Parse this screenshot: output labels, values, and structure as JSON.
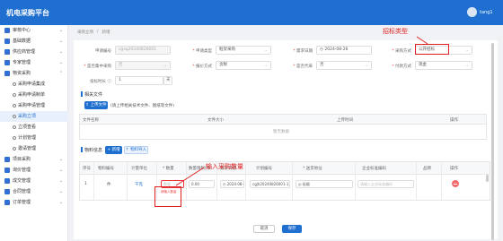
{
  "header": {
    "app_title": "机电采购平台",
    "user_name": "tang1"
  },
  "sidebar": {
    "items": [
      {
        "label": "审核中心",
        "type": "group"
      },
      {
        "label": "基础数据",
        "type": "group"
      },
      {
        "label": "供应商管理",
        "type": "group"
      },
      {
        "label": "专家管理",
        "type": "group"
      },
      {
        "label": "物资采购",
        "type": "group"
      },
      {
        "label": "采购申请集成",
        "type": "sub"
      },
      {
        "label": "采购申请制单",
        "type": "sub"
      },
      {
        "label": "采购申请管理",
        "type": "sub"
      },
      {
        "label": "采购立项",
        "type": "sub"
      },
      {
        "label": "立项查看",
        "type": "sub"
      },
      {
        "label": "计划管理",
        "type": "sub"
      },
      {
        "label": "邀请管理",
        "type": "sub"
      },
      {
        "label": "项目采购",
        "type": "group"
      },
      {
        "label": "询价管理",
        "type": "group"
      },
      {
        "label": "成交管理",
        "type": "group"
      },
      {
        "label": "合同管理",
        "type": "group"
      },
      {
        "label": "订单管理",
        "type": "group"
      }
    ]
  },
  "breadcrumb": [
    "采购立项",
    "新增"
  ],
  "form": {
    "fields": [
      {
        "label": "申请编号",
        "value": "cgsq20240826001",
        "disabled": true,
        "required": false
      },
      {
        "label": "申请类型",
        "value": "框架采购",
        "required": true,
        "select": true
      },
      {
        "label": "需求日期",
        "value": "2024-08-26",
        "required": true,
        "date": true
      },
      {
        "label": "采购方式",
        "value": "公开招标",
        "required": true,
        "select": true
      },
      {
        "label": "是否集中采购",
        "value": "否",
        "disabled": true,
        "required": true,
        "select": true
      },
      {
        "label": "报价方式",
        "value": "含税",
        "required": true,
        "select": true
      },
      {
        "label": "是否代采",
        "value": "否",
        "required": true,
        "select": true
      },
      {
        "label": "付款方式",
        "value": "现金",
        "required": true,
        "select": true
      }
    ],
    "bid_days": {
      "label": "投标时长",
      "value": "1",
      "unit": "天"
    }
  },
  "files": {
    "title": "相关文件",
    "upload_label": "上传文件",
    "note": "(请上传相关技术文件、图纸等文件)",
    "columns": [
      "文件名称",
      "文件大小",
      "上传时间",
      "操作"
    ],
    "empty": "暂无数据"
  },
  "materials": {
    "title": "物料信息",
    "add_label": "+ 新增",
    "import_label": "↑ 物料导入",
    "columns": [
      "序号",
      "物料编号",
      "计量单位",
      "* 数量",
      "数量限制(件)",
      "需求日期",
      "计划编号",
      "* 送货地址",
      "企业标准编码",
      "品牌",
      "操作"
    ],
    "rows": [
      {
        "index": "1",
        "code": "件",
        "unit": "千克",
        "qty_placeholder": "数量",
        "qty_error": "请输入数量",
        "limit": "0.00",
        "date": "2024-08-26",
        "plan_no": "cgjh20240826001-1",
        "address": "抚顺",
        "std_placeholder": "请输入企业标准编码"
      }
    ]
  },
  "footer": {
    "cancel_label": "取消",
    "submit_label": "保存"
  },
  "annotations": {
    "bid_type": "招标类型",
    "input_qty": "输入采购数量"
  }
}
